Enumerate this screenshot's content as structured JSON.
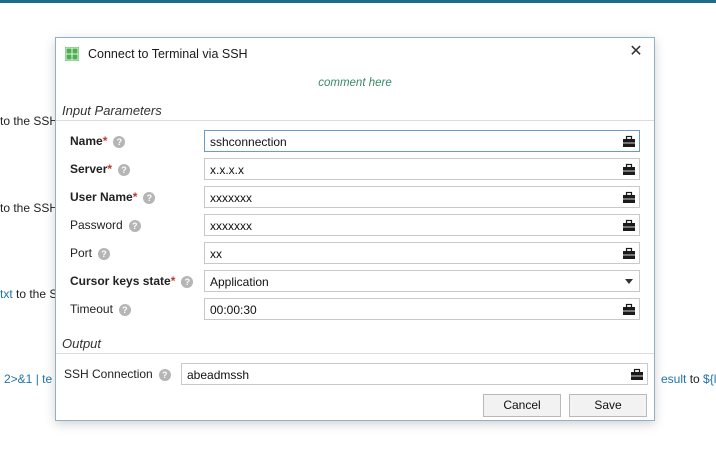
{
  "background": {
    "lines": [
      {
        "prefix": "",
        "text": "to the SSH",
        "accent": ""
      },
      {
        "prefix": "",
        "text": "to the SSH",
        "accent": ""
      },
      {
        "prefix": "txt",
        "text": " to the S",
        "accent": ""
      },
      {
        "prefix": "2>&1 | te",
        "text": "",
        "accent": ""
      }
    ],
    "right_snippet": {
      "accent_a": "esult",
      "plain": " to ",
      "accent_b": "${lsn"
    }
  },
  "dialog": {
    "title": "Connect to Terminal via SSH",
    "comment": "comment here",
    "close_symbol": "✕",
    "input_section_label": "Input Parameters",
    "output_section_label": "Output",
    "fields": [
      {
        "label": "Name",
        "required": "*",
        "bold": true,
        "value": "sshconnection",
        "icon": "briefcase-icon",
        "kind": "text"
      },
      {
        "label": "Server",
        "required": "*",
        "bold": true,
        "value": "x.x.x.x",
        "icon": "briefcase-icon",
        "kind": "text"
      },
      {
        "label": "User Name",
        "required": "*",
        "bold": true,
        "value": "xxxxxxx",
        "icon": "briefcase-icon",
        "kind": "text"
      },
      {
        "label": "Password",
        "required": "",
        "bold": false,
        "value": "xxxxxxx",
        "icon": "briefcase-icon",
        "kind": "text"
      },
      {
        "label": "Port",
        "required": "",
        "bold": false,
        "value": "xx",
        "icon": "briefcase-icon",
        "kind": "text"
      },
      {
        "label": "Cursor keys state",
        "required": "*",
        "bold": true,
        "value": "Application",
        "icon": "chevron-down-icon",
        "kind": "select"
      },
      {
        "label": "Timeout",
        "required": "",
        "bold": false,
        "value": "00:00:30",
        "icon": "briefcase-icon",
        "kind": "text"
      }
    ],
    "output": {
      "label": "SSH Connection",
      "value": "abeadmssh",
      "icon": "briefcase-icon"
    },
    "buttons": {
      "cancel": "Cancel",
      "save": "Save"
    },
    "help_symbol": "?",
    "colors": {
      "accent": "#1f6b8f",
      "required": "#c0392b",
      "comment": "#3a8a68",
      "focus_border": "#6a9bd0"
    }
  }
}
